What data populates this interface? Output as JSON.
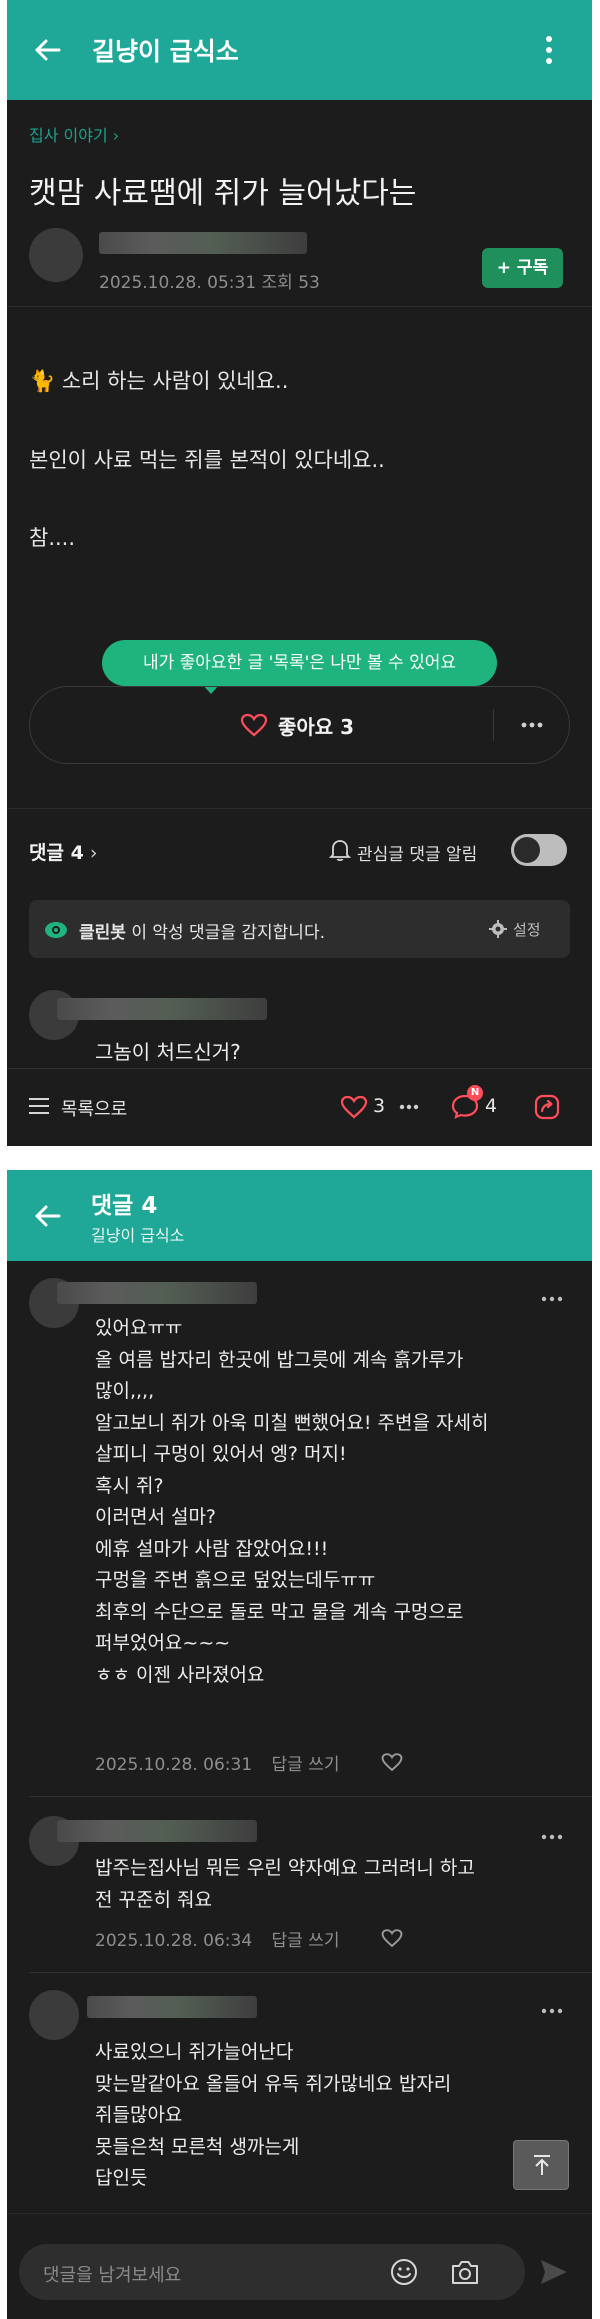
{
  "screen1": {
    "appbar": {
      "title": "길냥이 급식소"
    },
    "post": {
      "category": "집사 이야기",
      "title": "캣맘 사료땜에 쥐가 늘어났다는",
      "date": "2025.10.28. 05:31",
      "views": "조회 53",
      "subscribe_label": "+ 구독",
      "body": [
        "🐈 소리 하는 사람이 있네요..",
        "본인이 사료 먹는 쥐를 본적이 있다네요..",
        "참...."
      ],
      "tooltip": "내가 좋아요한 글 '목록'은 나만 볼 수 있어요",
      "like_label": "좋아요 3"
    },
    "comments_bar": {
      "label": "댓글 4",
      "alert_label": "관심글 댓글 알림"
    },
    "cleanbot": {
      "name": "클린봇",
      "text": "이 악성 댓글을 감지합니다.",
      "settings": "설정"
    },
    "preview_comment": "그놈이 처드신거?",
    "bottom_bar": {
      "list_label": "목록으로",
      "like_count": "3",
      "comment_count": "4",
      "new_badge": "N"
    }
  },
  "screen2": {
    "appbar": {
      "title": "댓글 4",
      "subtitle": "길냥이 급식소"
    },
    "comments": [
      {
        "lines": [
          "있어요ㅠㅠ",
          "올 여름 밥자리 한곳에 밥그릇에 계속 흙가루가",
          "많이,,,,",
          "알고보니 쥐가 아욱 미칠 뻔했어요! 주변을 자세히",
          "살피니 구멍이 있어서 엥? 머지!",
          "혹시 쥐?",
          "이러면서 설마?",
          "에휴 설마가 사람 잡았어요!!!",
          "구멍을 주변 흙으로 덮었는데두ㅠㅠ",
          "최후의 수단으로 돌로 막고 물을 계속 구멍으로",
          "퍼부었어요~~~",
          "ㅎㅎ 이젠 사라졌어요"
        ],
        "date": "2025.10.28. 06:31",
        "reply": "답글 쓰기"
      },
      {
        "lines": [
          "밥주는집사님 뭐든 우린 약자예요 그러려니 하고",
          "전 꾸준히 줘요"
        ],
        "date": "2025.10.28. 06:34",
        "reply": "답글 쓰기"
      },
      {
        "lines": [
          "사료있으니 쥐가늘어난다",
          "맞는말같아요 올들어 유독 쥐가많네요 밥자리",
          "쥐들많아요",
          "못들은척 모른척 생까는게",
          "답인듯"
        ]
      }
    ],
    "input": {
      "placeholder": "댓글을 남겨보세요"
    }
  },
  "colors": {
    "brand": "#1fa797",
    "like_red": "#ff4d5a",
    "background": "#1c1c1c",
    "subscribe": "#1f8f5b"
  }
}
